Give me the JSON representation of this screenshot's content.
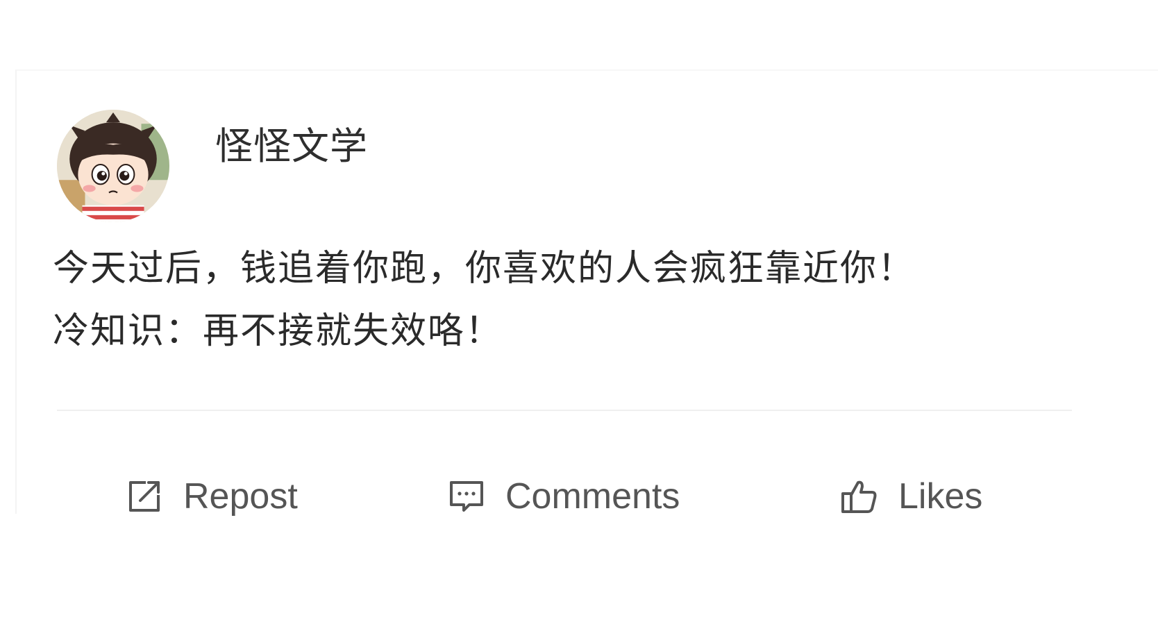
{
  "post": {
    "author": "怪怪文学",
    "body_lines": [
      "今天过后，钱追着你跑，你喜欢的人会疯狂靠近你！",
      "冷知识：再不接就失效咯！"
    ]
  },
  "actions": {
    "repost_label": "Repost",
    "comments_label": "Comments",
    "likes_label": "Likes"
  },
  "icons": {
    "repost": "repost-icon",
    "comments": "comment-icon",
    "likes": "thumbs-up-icon",
    "avatar": "cartoon-girl-avatar"
  },
  "colors": {
    "text_primary": "#2a2a2a",
    "text_action": "#555555",
    "divider": "#efefef",
    "background": "#ffffff"
  }
}
